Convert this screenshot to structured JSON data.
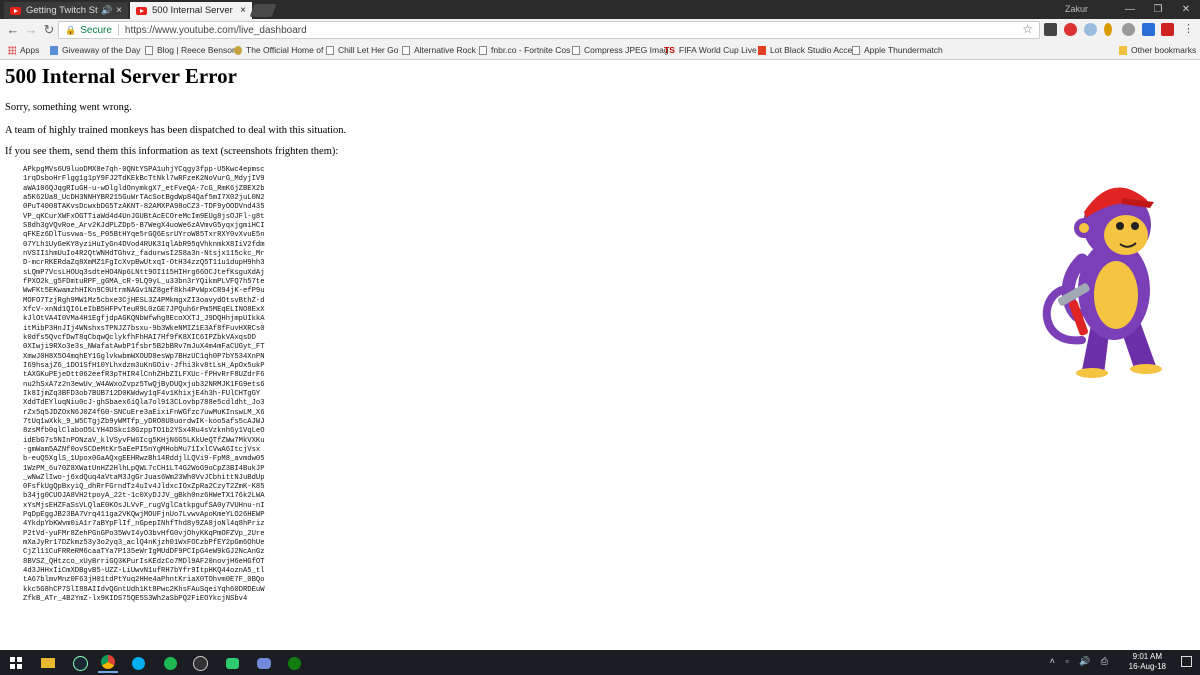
{
  "browser": {
    "tabs": [
      {
        "title": "Getting Twitch Stream",
        "active": false
      },
      {
        "title": "500 Internal Server Error",
        "active": true
      }
    ],
    "profile_name": "Zakur",
    "address": {
      "secure_label": "Secure",
      "url": "https://www.youtube.com/live_dashboard"
    },
    "bookmarks": [
      {
        "label": "Apps",
        "icon": "apps-icon"
      },
      {
        "label": "Giveaway of the Day",
        "icon": "page-icon"
      },
      {
        "label": "Blog | Reece Benson",
        "icon": "page-icon"
      },
      {
        "label": "The Official Home of",
        "icon": "page-icon"
      },
      {
        "label": "Chill Let Her Go",
        "icon": "youtube-icon"
      },
      {
        "label": "Alternative Rock",
        "icon": "youtube-icon"
      },
      {
        "label": "fnbr.co - Fortnite Cos",
        "icon": "page-icon"
      },
      {
        "label": "Compress JPEG Imag",
        "icon": "page-icon"
      },
      {
        "label": "FIFA World Cup Live S",
        "icon": "ts-icon"
      },
      {
        "label": "Lot Black Studio Acce",
        "icon": "page-icon"
      },
      {
        "label": "Apple Thundermatch",
        "icon": "page-icon"
      },
      {
        "label": "Other bookmarks",
        "icon": "folder-icon"
      }
    ],
    "ts_badge": "TS"
  },
  "page": {
    "title": "500 Internal Server Error",
    "line1": "Sorry, something went wrong.",
    "line2": "A team of highly trained monkeys has been dispatched to deal with this situation.",
    "line3": "If you see them, send them this information as text (screenshots frighten them):",
    "error_lines": [
      "APkpgMVs6U9luoDMX8e7qh-0QNtYSPA1uhjYCqgy3fpp-U5Kwc4epmsc",
      "1rqDsboHrFlgg1g1pY9FJ2TdKEkBcTtNkl7wRFzeK2NoVurG_MdyjIV9",
      "aWA106QJqgRIuGH-u-wDlgldOnymkgX7_etFveQA-7cG_RmK6jZBEX2b",
      "a5K62Ua8_UcDH3NNHYBR215GuWrTAcSotBgdWp84Qaf5mI7X02juL0N2",
      "0PuT4008TAKvsDcwxbDG5TzAKNT-82AMXPA98oCZ3-TDF9yOODVnd435",
      "VP_qKCurXWFxOGTTiaWd4d4UnJGUBtAcECOreMcIm9EUg8jsOJFl-g8t",
      "S8dh3gVQvRoe_Arv2KJdPLZDp5-B7WegX4uoWe6zAVmvG5yqxjgmiHCI",
      "qFKEz6DlTusvwa-5s_P05BtHYqe5rGQ6EsrUYroW85TxrRXY0vXvuE5n",
      "07YLh1UyGeKY8yziHuIyGn4DVod4RUK31qlAbR95qVhknmkX8IiV2fdm",
      "nVSII1hmUuIo4R2QtWNHdTGhvz_fadurwsI2S8a3n-Ntsjx115ckc_Mr",
      "D-mcrRKERdaZq8XmMZ1FgIcXvpBwUtxqI-OtH34zzQ5T11u1dupH9hh3",
      "sLQmP7VcsLHOUq3sdteHO4Np6LNtt9OI115HIHrg66OCJtefKsguXdAj",
      "fPXO2k_g5FDmtuRPF_gGMA_cR-9LQ9yL_u33bn3rYQikmPLVFQ7h57te",
      "WwFKt5EKwamzhHIKn9C9UtrmNAGv1NZ8gef8kh4PvWpxCR94jK-efP9u",
      "MOFO7TzjRgh9MW1Mz5cbxe3CjHESL3Z4PMkmgxZI3oavydOtsvBthZ-d",
      "XfcV-xnNd1QI6LeIbB5HFPvTeuR9L0zGE7JPQuh6rPm5MEqELINO8ExX",
      "kJlOtVA4I0VMa4H1EgfjdpAGKQNbWfwhg8EcoXXTJ_J9DQHhjmpUIkkA",
      "itMibP3HnJIj4WNshxsTPNJZ7bsxu-9b3WkeNMIZ1E3Af8fFuvHXRCs0",
      "k0dfs5QvcfDwT8qCbqwQclykfhFhHAI7Hf9fK8XIC6IPZbkVAxqsDD",
      "0XIwji9RXo3e3s_NWafatAwbP1fsbr5B2bBRv7mJuX4m4mFaCUGyt_FT",
      "XmwJ0H8X5O4mqhEY1GglvkwbmWXOUD8esWp7BHzUC1qh0P7bY534XnPN",
      "I69hsajZ6_1DO1SfH10YLhxdzm3uKnGOiv-Jfhi3kv8tLsH_ApOx5ukP",
      "tAXGKuPEjeDtt062eefR3pTHIR4lCnhZHbZILFXUc-fPHvRrF8UZdrF6",
      "nu2hSxA7z2n3ewUv_W4AWxoZvpz5TwQjByDUQxjub32NRMJK1FG9ets6",
      "Ik8IjmZq3BFD3ob7BUB712D0KWdwy1qF4v1KhixjE4h3h-FUlCHTgGY",
      "XddTdEYluqNiu0cJ-ghSbaex6iQla7ol913CLovbp788e5cdldht_Jo3",
      "rZx5q5JDZOxN6J0Z4fG0-SNCuEre3aEixiFnWGfzc7uwMuKInswLM_X6",
      "7tUq1wXkk_9_W5CTgjZb9yWMTfp_yDRO8U8uordwIK-koo5afs5cAJWJ",
      "8zsMfb0qlClaboO5LYH4DSkc18GzppTO1b2YSx4Ru4sVzknh6y1VqLeO",
      "idEbG7s5NInPONzaV_klVSyvFW6Icg5KHjN6G5LKkUeQTfZWw7MkVXKu",
      "-gmWam5AZNf0ovSCDeMtKr5aEePI5nYgMHobMu71IxlCVwA6ItcjVsx",
      "b-euQ5XglS_1Upox0GaAQxgEEHRwzBh14RddjlLQVi9-FpM8_avmdw05",
      "1WzPM_6u70Z8XWatUnHZ2HlhLpQWL7cCH1LT4G2WoG9oCpZ3BI4BukJP",
      "_wNwZlIwo-j6xdQuq4aVtaM3JgGrJuas6Wm23Wh0VvJCbhittNJuBdUp",
      "0FsfkUgQpBxyiQ_dhRrFGrndTz4uIv4JldxcIOxZpRa2CzyT2ZmK-K85",
      "b34jg0CUOJA8VH2tpoyA_22t-1c0XyDJJV_gBkh0nz6HWeTX176k2LWA",
      "xYsMjsEHZFaSsVLQlaE0KOsJLVvF_rugVglCatkpgufSA0y7VUHnu-nI",
      "PqDpEggJB23BA7Vrq411ga2VKQwjMOUFjnUo7LvwvApoKmeYLO26HEWP",
      "4YkdpYbKWvm0iA1r7aBYpFlIf_nGpepINhfThd8y9ZA8joNl4q8hPriz",
      "P2tVd-yuFMr8ZehPGnGPo35WvI4yO3bvHfG0vjOhyKKqPmOFZVp_2Ure",
      "mXaJyRr17DZkmz53y3o2yq3_aclQ4nKjzh01WxFOCzbPfEY2pGm6OhUe",
      "CjZl11CuFRReRM6caaTYa7P135eWrIgMUdDF9PCIpG4eW9kGJ2NcAnGz",
      "8BVSZ_QHtzco_xUyBrriGQ3KPurIsKEdzCo7MDl9AF20novjH6eHGfOT",
      "4d3JHHxIiCmXDBgvB5-UZZ-LiUwvN1ufRH7bYfr9ItpHKQ44oznA5_tl",
      "tA67blmvMnz0F63jH01tdPtYuq2HHe4aPhntKriaX0TOhvm0E7F_0BQo",
      "kkc5G8hCP7SlI88AIIdvQGntUdh1Kt8Pwc2KhsFAuSqeiYqh60DRDEuW",
      "ZfkB_ATr_4B2YmZ-lx9KIDS75QE5S3Wh2aSbPQ2FiEOYkcjNSbv4"
    ]
  },
  "taskbar": {
    "time": "9:01 AM",
    "date": "16-Aug-18"
  }
}
